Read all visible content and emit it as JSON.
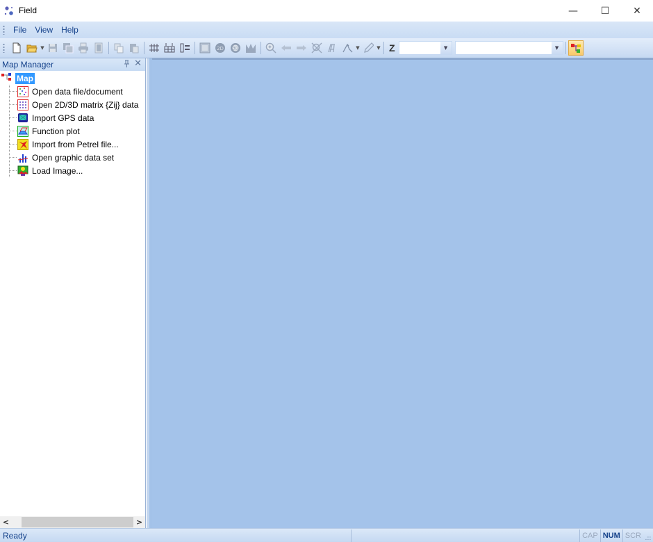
{
  "window": {
    "title": "Field",
    "icon": "app-dots-icon",
    "controls": {
      "minimize": "—",
      "maximize": "☐",
      "close": "✕"
    }
  },
  "menu": {
    "items": [
      {
        "label": "File"
      },
      {
        "label": "View"
      },
      {
        "label": "Help"
      }
    ]
  },
  "toolbar": {
    "buttons": [
      {
        "icon": "new-document-icon",
        "enabled": true
      },
      {
        "icon": "open-folder-icon",
        "enabled": true,
        "dropdown": true
      },
      {
        "icon": "save-icon",
        "enabled": false
      },
      {
        "icon": "save-all-icon",
        "enabled": false
      },
      {
        "icon": "print-icon",
        "enabled": false
      },
      {
        "icon": "print-preview-icon",
        "enabled": false
      },
      {
        "icon": "copy-icon",
        "enabled": false
      },
      {
        "icon": "paste-icon",
        "enabled": false
      },
      {
        "icon": "grid-icon",
        "enabled": true
      },
      {
        "icon": "table-icon",
        "enabled": true
      },
      {
        "icon": "list-icon",
        "enabled": true
      },
      {
        "icon": "frame-icon",
        "enabled": false
      },
      {
        "icon": "2d-icon",
        "enabled": false
      },
      {
        "icon": "3d-icon",
        "enabled": false
      },
      {
        "icon": "histogram-icon",
        "enabled": false
      },
      {
        "icon": "zoom-in-icon",
        "enabled": false
      },
      {
        "icon": "arrow-left-icon",
        "enabled": false
      },
      {
        "icon": "arrow-right-icon",
        "enabled": false
      },
      {
        "icon": "zoom-fit-icon",
        "enabled": false
      },
      {
        "icon": "axis-icon",
        "enabled": false
      },
      {
        "icon": "select-pointer-icon",
        "enabled": false,
        "dropdown": true
      },
      {
        "icon": "pen-icon",
        "enabled": false,
        "dropdown": true
      }
    ],
    "z_label": "Z",
    "z_combo_value": "",
    "second_combo_value": "",
    "combo_arrow": "▼",
    "dropdown_arrow": "▼",
    "layer_button_icon": "layer-tree-icon"
  },
  "map_manager": {
    "title": "Map Manager",
    "pin_glyph": "ᚚ",
    "pin_icon": "pin-icon",
    "close_glyph": "✕",
    "root": {
      "label": "Map",
      "icon": "map-tree-icon"
    },
    "items": [
      {
        "label": "Open data file/document",
        "icon": "scatter-data-icon"
      },
      {
        "label": "Open 2D/3D matrix {Zij} data",
        "icon": "matrix-icon"
      },
      {
        "label": "Import GPS data",
        "icon": "gps-icon"
      },
      {
        "label": "Function plot",
        "icon": "function-plot-icon"
      },
      {
        "label": "Import from Petrel file...",
        "icon": "petrel-icon"
      },
      {
        "label": "Open graphic data set",
        "icon": "bar-chart-icon"
      },
      {
        "label": "Load Image...",
        "icon": "image-icon"
      }
    ],
    "scroll_left": "<",
    "scroll_right": ">"
  },
  "status": {
    "text": "Ready",
    "indicators": [
      {
        "label": "CAP",
        "active": false
      },
      {
        "label": "NUM",
        "active": true
      },
      {
        "label": "SCR",
        "active": false
      }
    ],
    "grip": ".::"
  },
  "colors": {
    "workspace": "#a4c3ea",
    "menu_text": "#15428b",
    "selection": "#3399ff"
  }
}
